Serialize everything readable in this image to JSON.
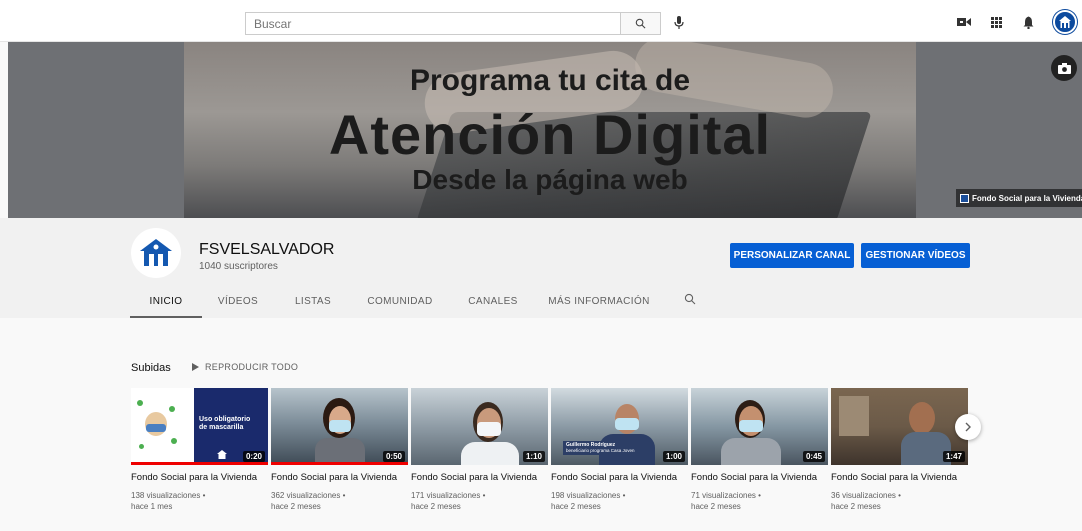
{
  "search": {
    "placeholder": "Buscar"
  },
  "banner": {
    "line1": "Programa tu cita de",
    "line2": "Atención Digital",
    "line3": "Desde la página web",
    "link_label": "Fondo Social para la Vivienda"
  },
  "channel": {
    "name": "FSVELSALVADOR",
    "subscribers": "1040 suscriptores",
    "customize_button": "PERSONALIZAR CANAL",
    "manage_button": "GESTIONAR VÍDEOS"
  },
  "tabs": [
    "INICIO",
    "VÍDEOS",
    "LISTAS",
    "COMUNIDAD",
    "CANALES",
    "MÁS INFORMACIÓN"
  ],
  "section": {
    "title": "Subidas",
    "play_all": "REPRODUCIR TODO"
  },
  "videos": [
    {
      "title": "Fondo Social para la Vivienda",
      "views": "138 visualizaciones •",
      "age": "hace 1 mes",
      "duration": "0:20",
      "thumb_text": "Uso obligatorio de mascarilla",
      "watched": true
    },
    {
      "title": "Fondo Social para la Vivienda",
      "views": "362 visualizaciones •",
      "age": "hace 2 meses",
      "duration": "0:50",
      "watched": true
    },
    {
      "title": "Fondo Social para la Vivienda",
      "views": "171 visualizaciones •",
      "age": "hace 2 meses",
      "duration": "1:10",
      "watched": false
    },
    {
      "title": "Fondo Social para la Vivienda",
      "views": "198 visualizaciones •",
      "age": "hace 2 meses",
      "duration": "1:00",
      "thumb_text": "Guillermo Rodríguez",
      "thumb_subtext": "beneficiario programa Casa Joven",
      "watched": false
    },
    {
      "title": "Fondo Social para la Vivienda",
      "views": "71 visualizaciones •",
      "age": "hace 2 meses",
      "duration": "0:45",
      "watched": false
    },
    {
      "title": "Fondo Social para la Vivienda",
      "views": "36 visualizaciones •",
      "age": "hace 2 meses",
      "duration": "1:47",
      "watched": false
    }
  ],
  "colors": {
    "primary_button": "#065fd4",
    "progress": "#ee0000",
    "brand": "#0c4a9e"
  },
  "icons": [
    "search-icon",
    "mic-icon",
    "video-camera-icon",
    "apps-icon",
    "bell-icon",
    "camera-icon",
    "chevron-right-icon",
    "play-icon"
  ]
}
